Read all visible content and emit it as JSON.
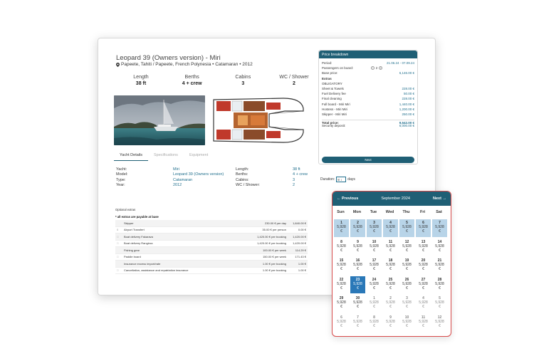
{
  "yacht": {
    "title": "Leopard 39 (Owners version) - Miri",
    "subtitle": "Papeete, Tahiti / Papeete, French Polynesia • Catamaran • 2012"
  },
  "stats": [
    {
      "label": "Length",
      "value": "38 ft"
    },
    {
      "label": "Berths",
      "value": "4 + crew"
    },
    {
      "label": "Cabins",
      "value": "3"
    },
    {
      "label": "WC / Shower",
      "value": "2"
    }
  ],
  "tabs": [
    "Yacht Details",
    "Specifications",
    "Equipment"
  ],
  "details": [
    {
      "k1": "Yacht:",
      "v1": "Miri",
      "k2": "Length:",
      "v2": "38 ft"
    },
    {
      "k1": "Model:",
      "v1": "Leopard 39 (Owners version)",
      "k2": "Berths:",
      "v2": "4 + crew"
    },
    {
      "k1": "Type:",
      "v1": "Catamaran",
      "k2": "Cabins:",
      "v2": "3"
    },
    {
      "k1": "Year:",
      "v1": "2012",
      "k2": "WC / Shower:",
      "v2": "2"
    }
  ],
  "extras": {
    "section_label": "Optional extras",
    "note": "* all extras are payable at base",
    "rows": [
      {
        "check": "",
        "name": "Skipper",
        "price": "230.00 € per day",
        "total": "1,840.00 €"
      },
      {
        "check": "0",
        "name": "Airport Transfert",
        "price": "35.00 € per person",
        "total": "0.00 €"
      },
      {
        "check": "□",
        "name": "Boat delivery Fakarava",
        "price": "1,420.00 € per booking",
        "total": "1,420.00 €"
      },
      {
        "check": "□",
        "name": "Boat delivery Rangiroa",
        "price": "1,420.00 € per booking",
        "total": "1,420.00 €"
      },
      {
        "check": "",
        "name": "Fishing gear",
        "price": "100.00 € per week",
        "total": "114.29 €"
      },
      {
        "check": "□",
        "name": "Paddle board",
        "price": "150.00 € per week",
        "total": "171.43 €"
      },
      {
        "check": "",
        "name": "Insurance excess import/rate",
        "price": "1.00 € per booking",
        "total": "1.00 €"
      },
      {
        "check": "□",
        "name": "Cancellation, assistance and repatriation insurance",
        "price": "1.00 € per booking",
        "total": "1.00 €"
      }
    ]
  },
  "price": {
    "header": "Price breakdown",
    "period_label": "Period:",
    "period_value": "21.06.24 - 07.09.24",
    "passengers_label": "Passengers on board:",
    "passengers_value": "2",
    "base_label": "Base price:",
    "base_value": "6,146.00 €",
    "extras_label": "Extras",
    "obligatory_label": "OBLIGATORY",
    "items": [
      {
        "k": "Sheet & Towels",
        "v": "228.00 €"
      },
      {
        "k": "Fuel Delivery fee",
        "v": "50.00 €"
      },
      {
        "k": "Final cleaning",
        "v": "228.00 €"
      },
      {
        "k": "Full board - Miri Miri",
        "v": "1,440.00 €"
      },
      {
        "k": "Hostess - Miri Miri",
        "v": "1,200.00 €"
      },
      {
        "k": "Skipper - Miri Miri",
        "v": "250.00 €"
      }
    ],
    "total_label": "Total price:",
    "total_value": "9,542.00 €",
    "deposit_label": "Security deposit:",
    "deposit_value": "6,000.00 €",
    "next_label": "Next"
  },
  "duration": {
    "label": "Duration:",
    "value": "8",
    "unit": "days"
  },
  "calendar": {
    "prev_label": "← Previous",
    "month_label": "September 2024",
    "next_label": "Next →",
    "weekdays": [
      "Sun",
      "Mon",
      "Tue",
      "Wed",
      "Thu",
      "Fri",
      "Sat"
    ],
    "price": "5,928",
    "currency": "€",
    "days": [
      "1",
      "2",
      "3",
      "4",
      "5",
      "6",
      "7",
      "8",
      "9",
      "10",
      "11",
      "12",
      "13",
      "14",
      "15",
      "16",
      "17",
      "18",
      "19",
      "20",
      "21",
      "22",
      "23",
      "24",
      "25",
      "26",
      "27",
      "28",
      "29",
      "30",
      "1",
      "2",
      "3",
      "4",
      "5",
      "6",
      "7",
      "8",
      "9",
      "10",
      "11",
      "12"
    ],
    "highlighted_days": [
      "1",
      "2",
      "3",
      "4",
      "5",
      "6",
      "7"
    ],
    "selected_day": "23"
  },
  "colors": {
    "brand": "#1f5f75",
    "link": "#1f6e8c",
    "highlight": "#b8d4e8",
    "selected": "#2a78b8",
    "calendar_border": "#d84a4a"
  }
}
